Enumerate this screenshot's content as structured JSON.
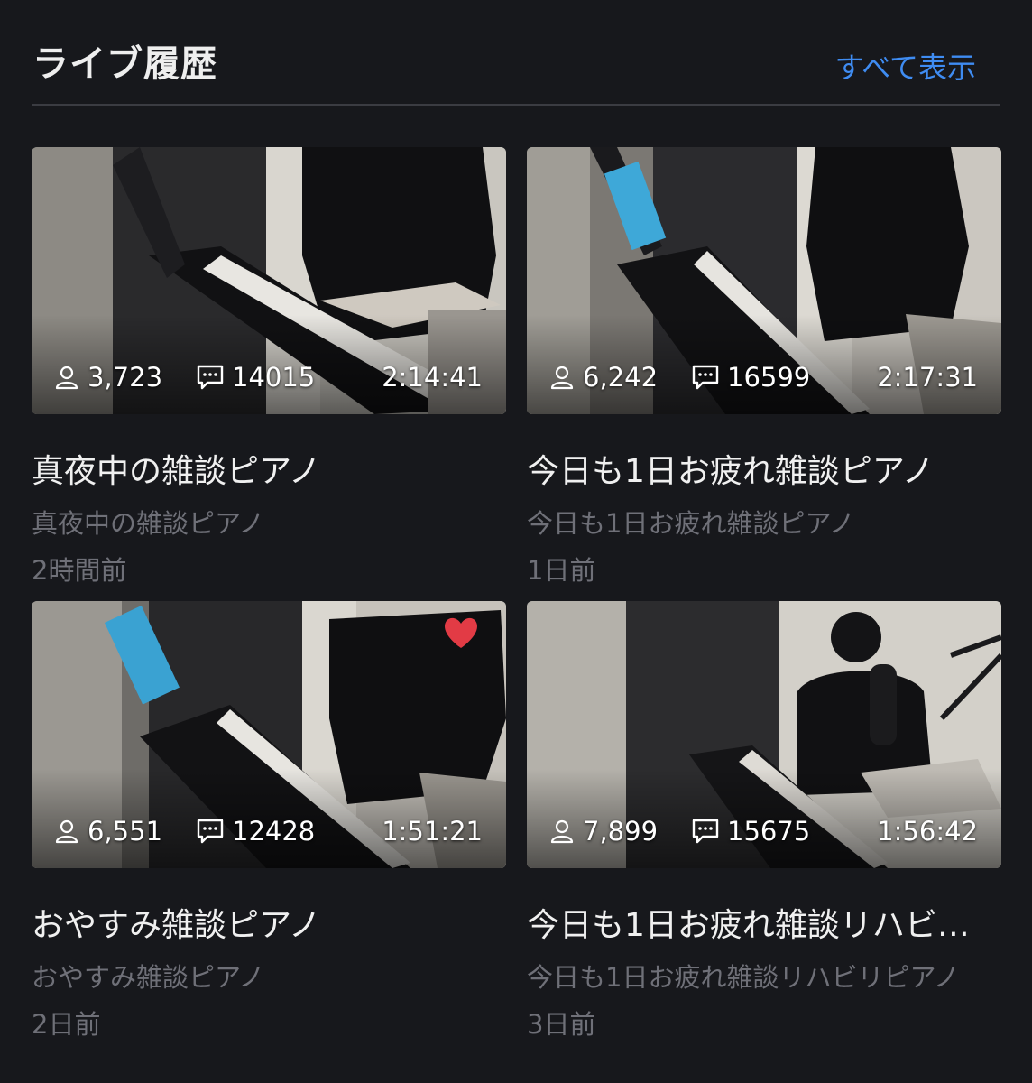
{
  "section": {
    "title": "ライブ履歴",
    "see_all_label": "すべて表示",
    "accent_color": "#3f8cf2"
  },
  "icons": {
    "viewers": "person-icon",
    "comments": "comment-bubble-icon"
  },
  "videos": [
    {
      "viewers": "3,723",
      "comments": "14015",
      "duration": "2:14:41",
      "title": "真夜中の雑談ピアノ",
      "subtitle": "真夜中の雑談ピアノ",
      "time": "2時間前"
    },
    {
      "viewers": "6,242",
      "comments": "16599",
      "duration": "2:17:31",
      "title": "今日も1日お疲れ雑談ピアノ",
      "subtitle": "今日も1日お疲れ雑談ピアノ",
      "time": "1日前"
    },
    {
      "viewers": "6,551",
      "comments": "12428",
      "duration": "1:51:21",
      "title": "おやすみ雑談ピアノ",
      "subtitle": "おやすみ雑談ピアノ",
      "time": "2日前"
    },
    {
      "viewers": "7,899",
      "comments": "15675",
      "duration": "1:56:42",
      "title": "今日も1日お疲れ雑談リハビリピアノ",
      "subtitle": "今日も1日お疲れ雑談リハビリピアノ",
      "time": "3日前"
    }
  ]
}
